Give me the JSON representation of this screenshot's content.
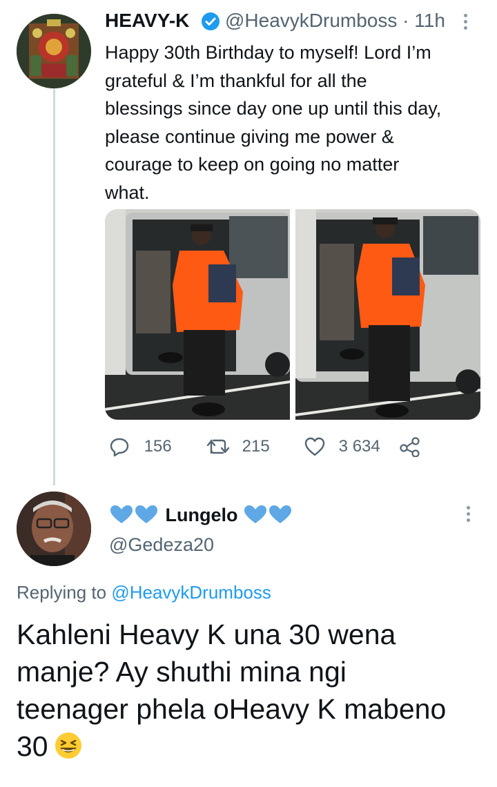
{
  "tweet": {
    "display_name": "HEAVY-K",
    "handle_time": "@HeavykDrumboss · 11h",
    "text": "Happy 30th Birthday to myself! Lord I’m\ngrateful & I’m thankful for all the\nblessings since day one up until this day,\nplease continue giving me power &\ncourage to keep on going no matter\nwhat.",
    "actions": {
      "replies": "156",
      "retweets": "215",
      "likes": "3 634"
    }
  },
  "reply": {
    "display_name": "Lungelo",
    "handle": "@Gedeza20",
    "replying_prefix": "Replying to",
    "replying_to": "@HeavykDrumboss",
    "text": "Kahleni Heavy K una 30 wena\nmanje? Ay shuthi mina ngi\nteenager phela oHeavy K mabeno\n30",
    "emoji": "grinning-squinting-face"
  },
  "colors": {
    "accent": "#1d9bf0",
    "secondary_text": "#536471",
    "jacket_orange": "#ff5a14"
  }
}
